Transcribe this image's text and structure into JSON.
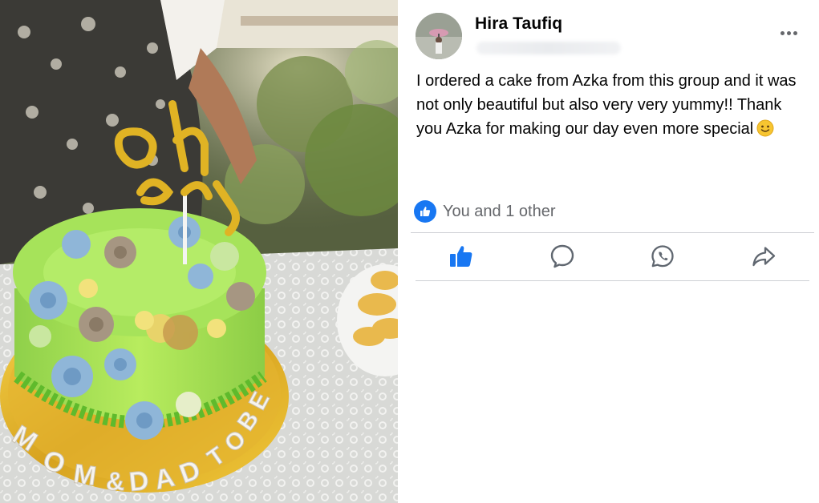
{
  "post": {
    "author": {
      "name": "Hira Taufiq",
      "avatar_icon": "profile-photo"
    },
    "more_icon": "more-dots-icon",
    "text": "I ordered a cake from Azka from this group and it was not only beautiful but also very very yummy!! Thank you Azka for making our day even more special",
    "emoji": "slightly-smiling-face",
    "reactions": {
      "icon": "like-icon",
      "text": "You and 1 other"
    },
    "actions": [
      {
        "name": "like",
        "icon": "thumbs-up-icon",
        "active": true
      },
      {
        "name": "comment",
        "icon": "comment-bubble-icon"
      },
      {
        "name": "whatsapp",
        "icon": "whatsapp-icon"
      },
      {
        "name": "share",
        "icon": "share-arrow-icon"
      }
    ],
    "photo": {
      "topper_text": "Oh Baby",
      "board_text": "MOM & DAD TO BE"
    }
  },
  "colors": {
    "accent": "#1877f2",
    "secondary_text": "#65676b",
    "divider": "#ced0d4"
  }
}
